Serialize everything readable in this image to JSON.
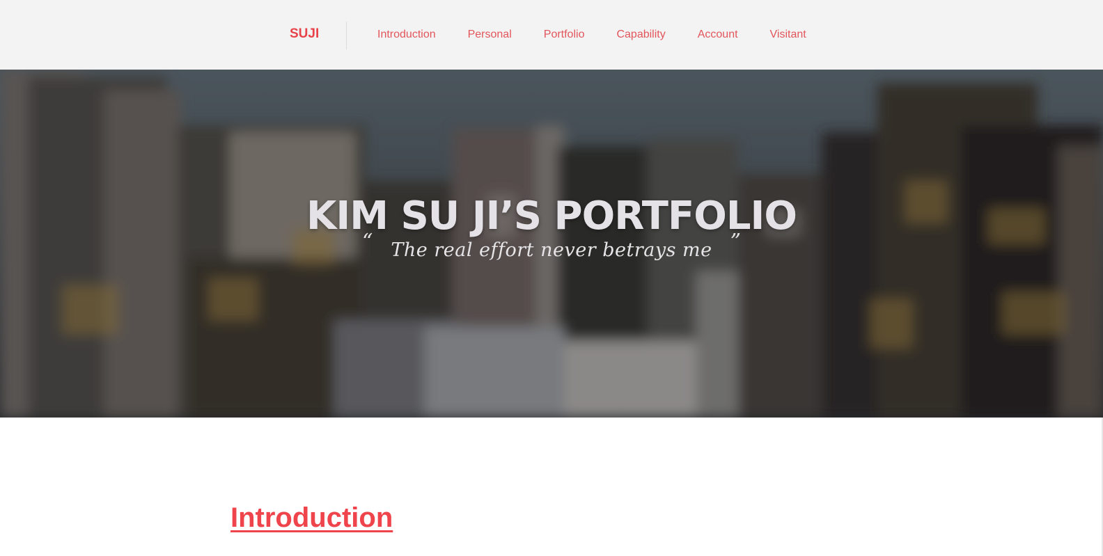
{
  "navbar": {
    "brand": "SUJI",
    "links": [
      {
        "label": "Introduction"
      },
      {
        "label": "Personal"
      },
      {
        "label": "Portfolio"
      },
      {
        "label": "Capability"
      },
      {
        "label": "Account"
      },
      {
        "label": "Visitant"
      }
    ]
  },
  "hero": {
    "title": "KIM SU JI’S PORTFOLIO",
    "quote_open": "“",
    "quote": "The real effort never betrays me",
    "quote_close": "”"
  },
  "sections": {
    "introduction_heading": "Introduction"
  },
  "colors": {
    "accent": "#ef444b",
    "navbar_bg": "#f3f3f3",
    "hero_text": "#e4e2e6"
  }
}
